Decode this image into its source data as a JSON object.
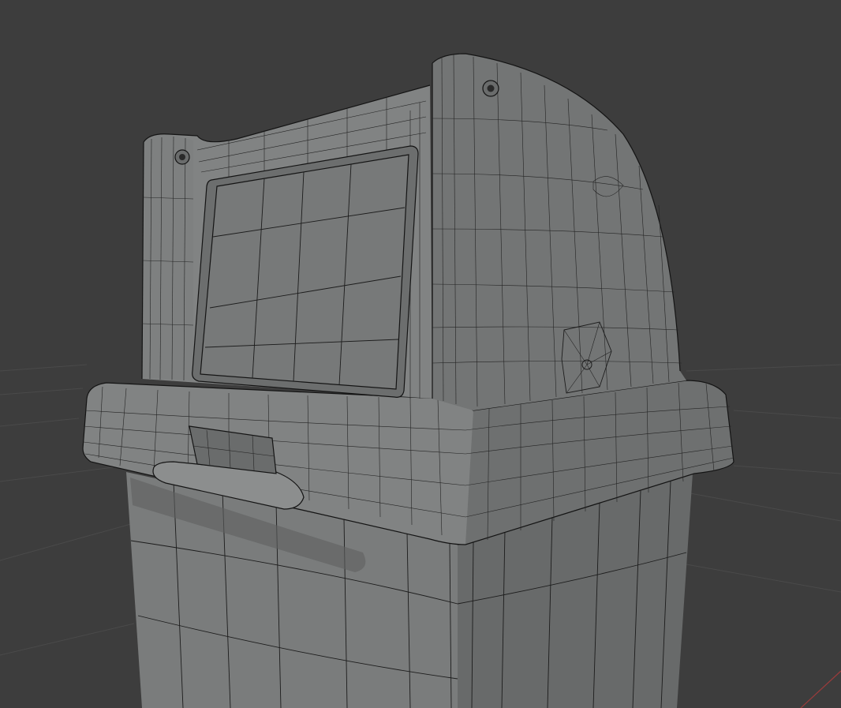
{
  "viewport": {
    "background": "#3d3d3d",
    "floor_grid_color": "#4a4a4a",
    "x_axis_color": "#9a3b3b"
  },
  "model": {
    "shading": "solid-gray-with-wireframe",
    "body_color": "#7c7e7e",
    "light_face_color": "#8a8c8c",
    "dark_face_color": "#5e6060",
    "wire_color": "#1c1c1c"
  },
  "icons": {
    "screw_left": "screw-icon",
    "screw_top": "screw-icon",
    "side_vertex_pole": "vertex-pole-icon"
  }
}
